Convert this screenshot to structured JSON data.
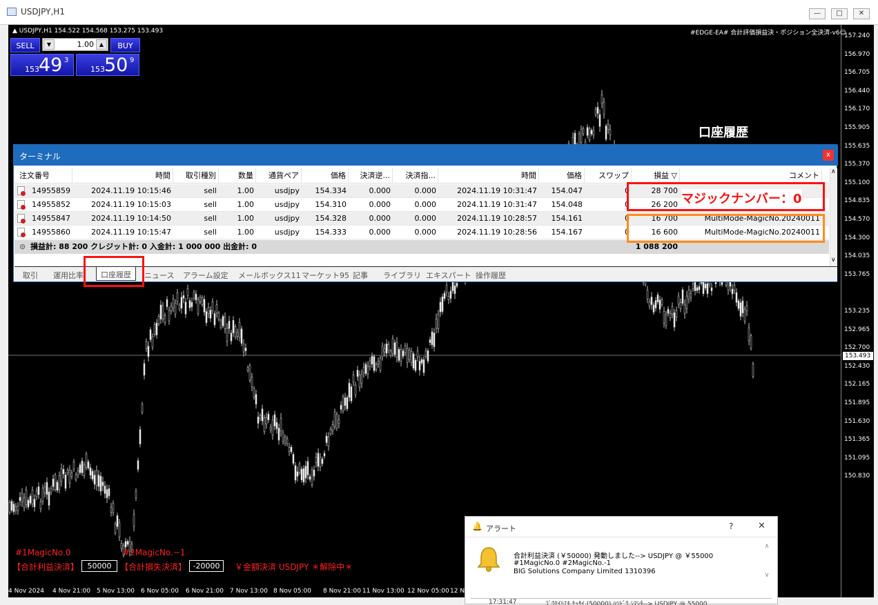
{
  "window": {
    "title": "USDJPY,H1",
    "min": "—",
    "max": "□",
    "close": "✕"
  },
  "chart": {
    "symbol_line": "▲ USDJPY,H1  154.522 154.568 153.275 153.493",
    "ea_title": "#EDGE-EA# 合計評価損益決・ポジション全決済-v6☺",
    "current_price": "153.493",
    "price_ticks": [
      "157.240",
      "156.970",
      "156.705",
      "156.440",
      "156.170",
      "155.905",
      "155.635",
      "155.370",
      "155.100",
      "154.835",
      "154.570",
      "154.300",
      "154.035",
      "153.765",
      "153.493",
      "153.235",
      "152.965",
      "152.700",
      "152.430",
      "152.165",
      "151.895",
      "151.630",
      "151.365",
      "151.095",
      "150.830"
    ],
    "time_ticks": [
      "4 Nov 2024",
      "4 Nov 21:00",
      "5 Nov 13:00",
      "6 Nov 05:00",
      "6 Nov 21:00",
      "7 Nov 13:00",
      "8 Nov 05:00",
      "8 Nov 21:00",
      "11 Nov 13:00",
      "12 Nov 05:00",
      "12 N"
    ]
  },
  "trade_panel": {
    "sell_label": "SELL",
    "buy_label": "BUY",
    "lot": "1.00",
    "down": "▼",
    "up": "▲",
    "sell_small": "153",
    "sell_big": "49",
    "sell_sup": "3",
    "buy_small": "153",
    "buy_big": "50",
    "buy_sup": "9"
  },
  "ea_panel": {
    "magic1": "#1MagicNo.0",
    "magic2": "#2MagicNo.−1",
    "profit_label": "【合計利益決済】",
    "profit_value": "50000",
    "loss_label": "【合計損失決済】",
    "loss_value": "-20000",
    "amount_label": "￥金額決済 USDJPY ＊解除中＊"
  },
  "annotation": {
    "title": "口座履歴",
    "magic0": "マジックナンバー：0"
  },
  "terminal": {
    "title": "ターミナル",
    "close": "x",
    "headers": [
      "注文番号",
      "時間",
      "取引種別",
      "数量",
      "通貨ペア",
      "価格",
      "決済逆...",
      "決済指...",
      "時間",
      "価格",
      "スワップ",
      "損益 ▽",
      "コメント"
    ],
    "rows": [
      [
        "14955859",
        "2024.11.19 10:15:46",
        "sell",
        "1.00",
        "usdjpy",
        "154.334",
        "0.000",
        "0.000",
        "2024.11.19 10:31:47",
        "154.047",
        "0",
        "28 700",
        ""
      ],
      [
        "14955852",
        "2024.11.19 10:15:03",
        "sell",
        "1.00",
        "usdjpy",
        "154.310",
        "0.000",
        "0.000",
        "2024.11.19 10:31:47",
        "154.048",
        "0",
        "26 200",
        ""
      ],
      [
        "14955847",
        "2024.11.19 10:14:50",
        "sell",
        "1.00",
        "usdjpy",
        "154.328",
        "0.000",
        "0.000",
        "2024.11.19 10:28:57",
        "154.161",
        "0",
        "16 700",
        "MultiMode-MagicNo.20240011"
      ],
      [
        "14955860",
        "2024.11.19 10:15:47",
        "sell",
        "1.00",
        "usdjpy",
        "154.333",
        "0.000",
        "0.000",
        "2024.11.19 10:28:56",
        "154.167",
        "0",
        "16 600",
        "MultiMode-MagicNo.20240011"
      ]
    ],
    "totals": "損益計: 88 200  クレジット計: 0  入金計: 1 000 000  出金計: 0",
    "totals_icon": "⊙",
    "balance": "1 088 200",
    "scroll_up": "∧",
    "scroll_down": "∨",
    "tabs": [
      "取引",
      "運用比率",
      "口座履歴",
      "ニュース",
      "アラーム設定",
      "メールボックス",
      "マーケット",
      "記事",
      "ライブラリ",
      "エキスパート",
      "操作履歴"
    ],
    "mail_badge": "11",
    "market_badge": "95"
  },
  "alert": {
    "title": "アラート",
    "help": "?",
    "close": "✕",
    "line1": "合計利益決済 (￥50000) 発動しました--> USDJPY @ ￥55000",
    "line2": "#1MagicNo.0  #2MagicNo.-1",
    "line3": "BIG Solutions Company Limited   1310396",
    "row_time": "17:31:47",
    "row_text": "ｺﾞｳｹｲﾘｴｷ ｹｯｻｲ (50000) ﾊﾂﾄﾞｳ ｼﾏｼﾀ--> USDJPY @ 55000",
    "scroll_up": "∧",
    "scroll_down": "∨"
  }
}
